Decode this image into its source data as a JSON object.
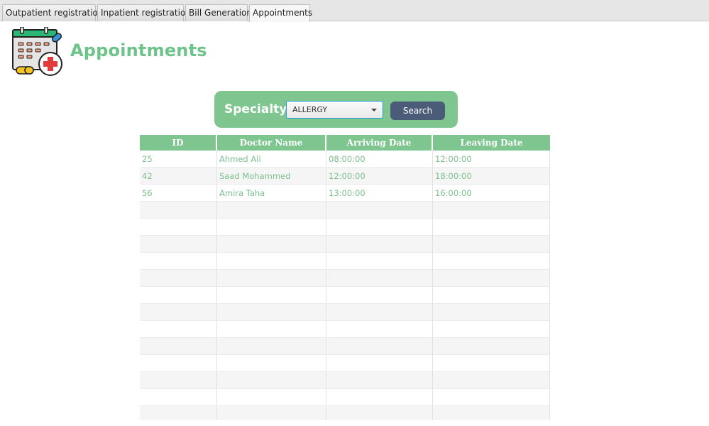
{
  "tabs": [
    {
      "label": "Outpatient registration",
      "active": false
    },
    {
      "label": "Inpatient registration",
      "active": false
    },
    {
      "label": "Bill Generation",
      "active": false
    },
    {
      "label": "Appointments",
      "active": true
    }
  ],
  "header": {
    "title": "Appointments",
    "logo_icon": "calendar-medical-icon"
  },
  "search": {
    "label": "Specialty",
    "selected": "ALLERGY",
    "button_label": "Search"
  },
  "table": {
    "columns": [
      "ID",
      "Doctor Name",
      "Arriving Date",
      "Leaving Date"
    ],
    "rows": [
      [
        "25",
        "Ahmed Ali",
        "08:00:00",
        "12:00:00"
      ],
      [
        "42",
        "Saad Mohammed",
        "12:00:00",
        "18:00:00"
      ],
      [
        "56",
        "Amira Taha",
        "13:00:00",
        "16:00:00"
      ]
    ]
  },
  "colors": {
    "accent": "#7fc58f",
    "title": "#6dc48b",
    "button": "#4b5c78"
  }
}
